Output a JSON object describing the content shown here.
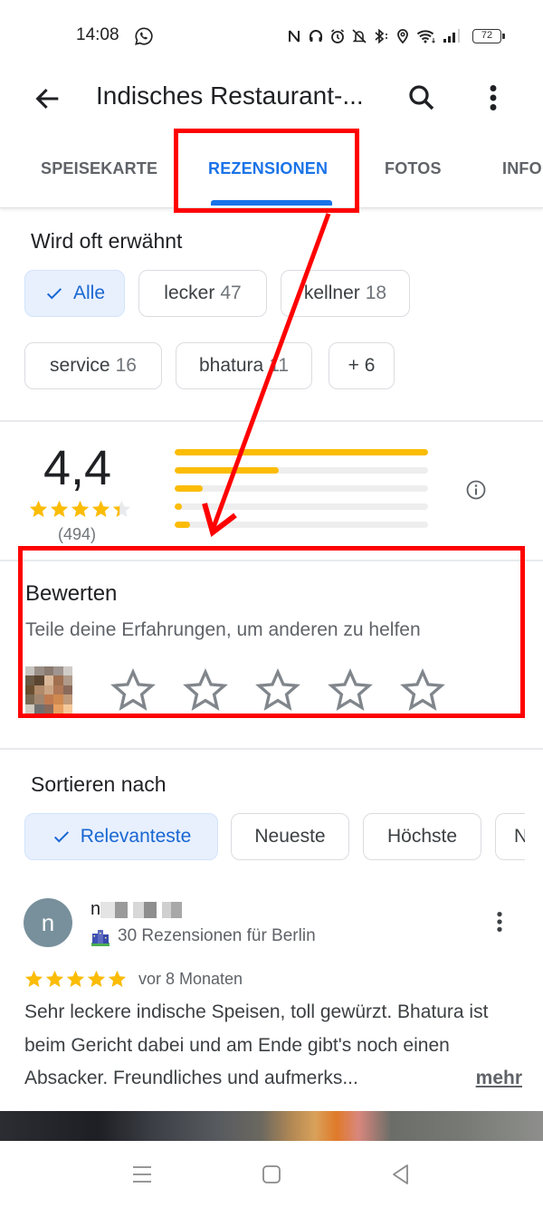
{
  "status_bar": {
    "time": "14:08",
    "battery": "72",
    "icons": [
      "whatsapp-icon",
      "nfc-icon",
      "headphones-icon",
      "alarm-icon",
      "notifications-off-icon",
      "bluetooth-icon",
      "location-icon",
      "wifi-icon",
      "signal-icon",
      "battery-icon"
    ]
  },
  "app_bar": {
    "title": "Indisches Restaurant-...",
    "back_icon": "arrow-back-icon",
    "search_icon": "search-icon",
    "more_icon": "more-vert-icon"
  },
  "tabs": [
    {
      "label": "SPEISEKARTE",
      "active": false
    },
    {
      "label": "REZENSIONEN",
      "active": true
    },
    {
      "label": "FOTOS",
      "active": false
    },
    {
      "label": "INFO",
      "active": false
    }
  ],
  "mentions": {
    "title": "Wird oft erwähnt",
    "chips": [
      {
        "label": "Alle",
        "count": "",
        "selected": true
      },
      {
        "label": "lecker",
        "count": "47",
        "selected": false
      },
      {
        "label": "kellner",
        "count": "18",
        "selected": false
      },
      {
        "label": "service",
        "count": "16",
        "selected": false
      },
      {
        "label": "bhatura",
        "count": "11",
        "selected": false
      },
      {
        "label": "+ 6",
        "count": "",
        "selected": false
      }
    ]
  },
  "rating_summary": {
    "average": "4,4",
    "stars": 4.4,
    "total": "(494)",
    "distribution": [
      {
        "stars": 5,
        "fraction": 1.0
      },
      {
        "stars": 4,
        "fraction": 0.41
      },
      {
        "stars": 3,
        "fraction": 0.11
      },
      {
        "stars": 2,
        "fraction": 0.03
      },
      {
        "stars": 1,
        "fraction": 0.06
      }
    ],
    "info_icon": "info-icon"
  },
  "rate_prompt": {
    "title": "Bewerten",
    "subtitle": "Teile deine Erfahrungen, um anderen zu helfen",
    "star_count": 5,
    "selected": 0
  },
  "sort": {
    "title": "Sortieren nach",
    "options": [
      {
        "label": "Relevanteste",
        "selected": true
      },
      {
        "label": "Neueste",
        "selected": false
      },
      {
        "label": "Höchste",
        "selected": false
      },
      {
        "label": "N",
        "selected": false
      }
    ]
  },
  "review": {
    "avatar_letter": "n",
    "author": "n",
    "meta": "30 Rezensionen für Berlin",
    "rating": 5,
    "date": "vor 8 Monaten",
    "text": "Sehr leckere indische Speisen, toll gewürzt. Bhatura ist beim Gericht dabei und am Ende gibt's noch einen Absacker. Freundliches und aufmerks...",
    "more_label": "mehr"
  },
  "nav_bar": {
    "buttons": [
      "menu-icon",
      "home-icon",
      "back-triangle-icon"
    ]
  },
  "annotations": {
    "color": "#ff0000",
    "highlights": [
      "tab-reviews",
      "rate-section"
    ],
    "arrow": "tab-reviews → rate-section"
  },
  "colors": {
    "accent": "#1a73e8",
    "star": "#fbbc04",
    "chip_selected_bg": "#e8f0fe"
  }
}
